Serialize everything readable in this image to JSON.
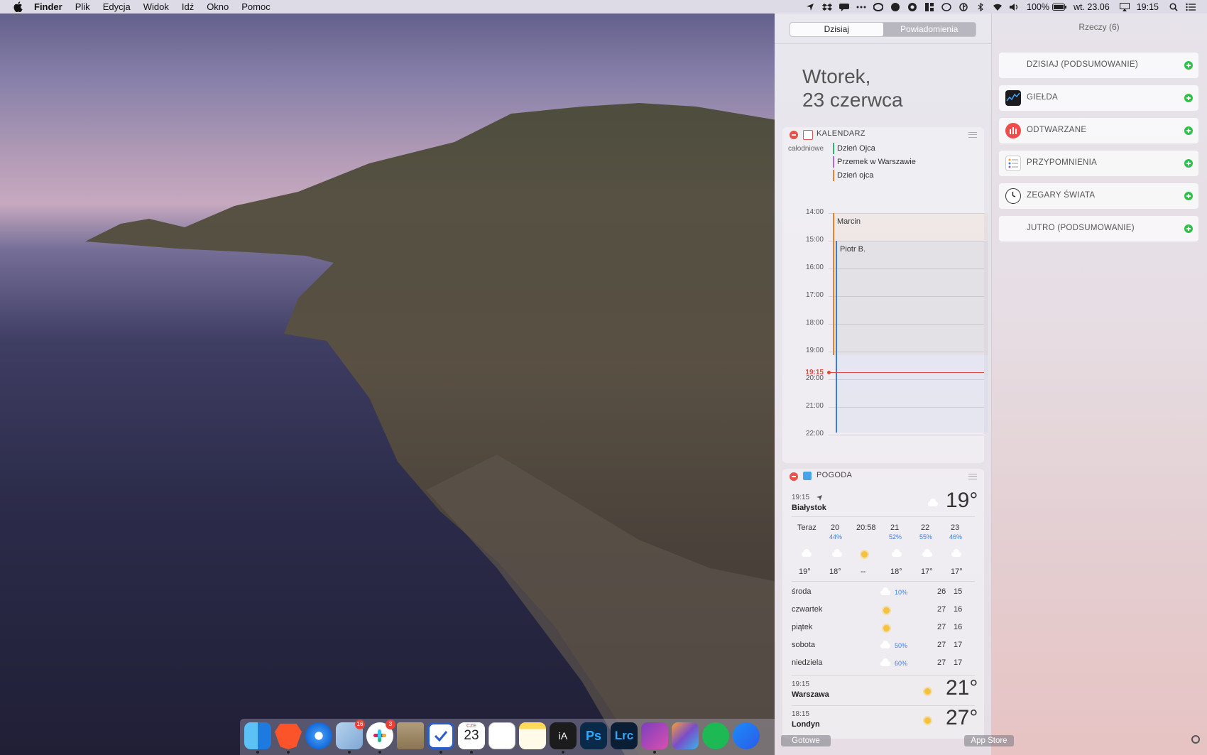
{
  "menubar": {
    "app_name": "Finder",
    "menus": [
      "Plik",
      "Edycja",
      "Widok",
      "Idź",
      "Okno",
      "Pomoc"
    ],
    "battery": "100%",
    "date": "wt. 23.06",
    "time": "19:15",
    "status_icons": [
      "location-icon",
      "dropbox-icon",
      "messages-icon",
      "more-icon",
      "creative-cloud-icon",
      "flux-icon",
      "vpn-icon",
      "spaces-icon",
      "time-machine-icon",
      "bluetooth-icon",
      "wifi-icon",
      "volume-icon",
      "battery-icon",
      "airplay-icon",
      "spotlight-icon",
      "notification-center-icon"
    ]
  },
  "notification_center": {
    "tabs": {
      "today": "Dzisiaj",
      "notifications": "Powiadomienia"
    },
    "date_line1": "Wtorek,",
    "date_line2": "23 czerwca",
    "calendar": {
      "title": "KALENDARZ",
      "allday_label": "całodniowe",
      "allday_events": [
        {
          "name": "Dzień Ojca",
          "color": "#2fb574"
        },
        {
          "name": "Przemek w Warszawie",
          "color": "#b36ad6"
        },
        {
          "name": "Dzień ojca",
          "color": "#f0812c"
        }
      ],
      "hours": [
        "14:00",
        "15:00",
        "16:00",
        "17:00",
        "18:00",
        "19:00",
        "20:00",
        "21:00",
        "22:00"
      ],
      "events": [
        {
          "name": "Marcin",
          "color": "#f0812c"
        },
        {
          "name": "Piotr B.",
          "color": "#3b7ae6"
        }
      ],
      "now_label": "19:15"
    },
    "weather": {
      "title": "POGODA",
      "current_time": "19:15",
      "location": "Białystok",
      "current_temp": "19°",
      "hourly": [
        {
          "label": "Teraz",
          "pct": "",
          "icon": "cloud-icon",
          "temp": "19°"
        },
        {
          "label": "20",
          "pct": "44%",
          "icon": "rain-icon",
          "temp": "18°"
        },
        {
          "label": "20:58",
          "pct": "",
          "icon": "sunset-icon",
          "temp": "--"
        },
        {
          "label": "21",
          "pct": "52%",
          "icon": "rain-icon",
          "temp": "18°"
        },
        {
          "label": "22",
          "pct": "55%",
          "icon": "rain-icon",
          "temp": "17°"
        },
        {
          "label": "23",
          "pct": "46%",
          "icon": "rain-icon",
          "temp": "17°"
        }
      ],
      "daily": [
        {
          "day": "środa",
          "icon": "partly-cloudy-icon",
          "pct": "10%",
          "high": "26",
          "low": "15"
        },
        {
          "day": "czwartek",
          "icon": "sun-icon",
          "pct": "",
          "high": "27",
          "low": "16"
        },
        {
          "day": "piątek",
          "icon": "sun-icon",
          "pct": "",
          "high": "27",
          "low": "16"
        },
        {
          "day": "sobota",
          "icon": "thunder-icon",
          "pct": "50%",
          "high": "27",
          "low": "17"
        },
        {
          "day": "niedziela",
          "icon": "thunder-icon",
          "pct": "60%",
          "high": "27",
          "low": "17"
        }
      ],
      "cities": [
        {
          "time": "19:15",
          "name": "Warszawa",
          "temp": "21°"
        },
        {
          "time": "18:15",
          "name": "Londyn",
          "temp": "27°"
        }
      ]
    },
    "items_title": "Rzeczy (6)",
    "items": [
      {
        "label": "DZISIAJ (PODSUMOWANIE)",
        "icon": ""
      },
      {
        "label": "GIEŁDA",
        "icon": "stocks-icon"
      },
      {
        "label": "ODTWARZANE",
        "icon": "now-playing-icon"
      },
      {
        "label": "PRZYPOMNIENIA",
        "icon": "reminders-icon"
      },
      {
        "label": "ZEGARY ŚWIATA",
        "icon": "world-clock-icon"
      },
      {
        "label": "JUTRO (PODSUMOWANIE)",
        "icon": ""
      }
    ],
    "done_button": "Gotowe",
    "app_store_button": "App Store"
  },
  "dock": {
    "apps": [
      "finder-icon",
      "brave-icon",
      "safari-icon",
      "mail-icon",
      "slack-icon",
      "archive-icon",
      "things-icon",
      "calendar-icon",
      "reminders-icon",
      "notes-icon",
      "ia-writer-icon",
      "photoshop-icon",
      "lightroom-icon",
      "affinity-icon",
      "final-cut-icon",
      "spotify-icon",
      "messenger-icon"
    ],
    "mail_badge": "16",
    "slack_badge": "3",
    "calendar_month": "CZE",
    "calendar_day": "23",
    "ia_label": "iA",
    "ps_label": "Ps",
    "lrc_label": "Lrc"
  }
}
